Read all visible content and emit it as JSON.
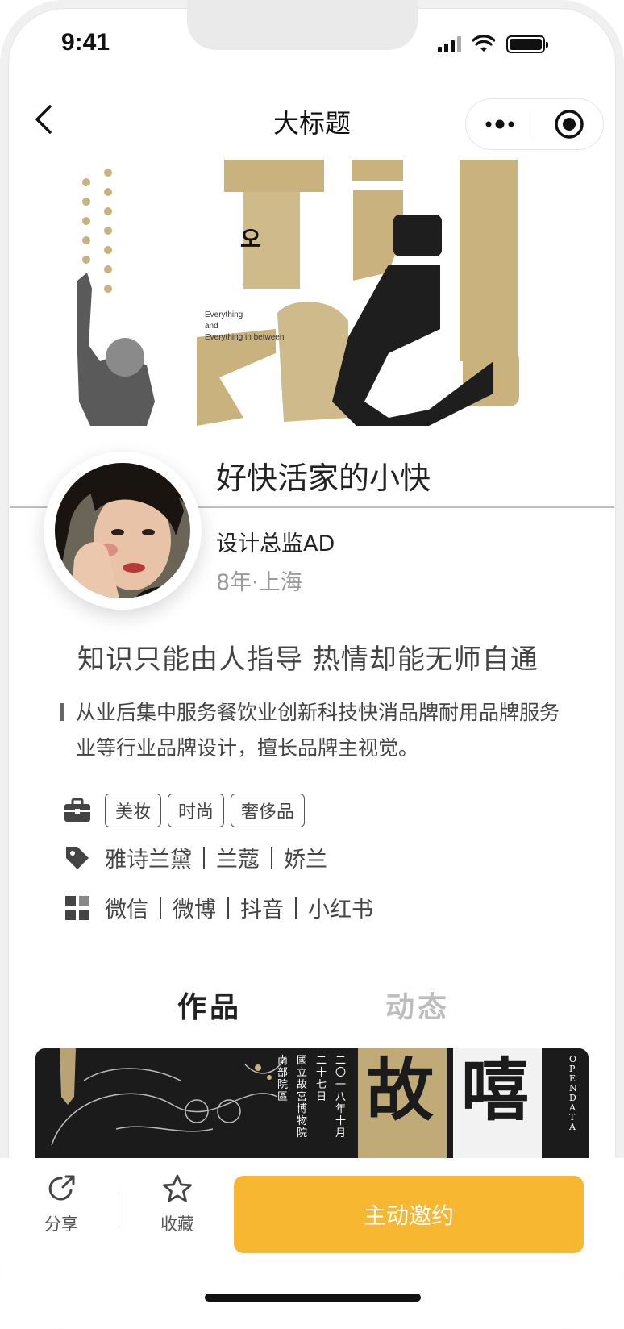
{
  "status_bar": {
    "time": "9:41"
  },
  "nav": {
    "title": "大标题"
  },
  "hero": {
    "poster_lines": [
      "Everything",
      "and",
      "Everything in between"
    ]
  },
  "profile": {
    "name": "好快活家的小快",
    "role": "设计总监AD",
    "meta": "8年·上海"
  },
  "motto": "知识只能由人指导 热情却能无师自通",
  "bio": "从业后集中服务餐饮业创新科技快消品牌耐用品牌服务业等行业品牌设计，擅长品牌主视觉。",
  "industries": [
    "美妆",
    "时尚",
    "奢侈品"
  ],
  "brands": [
    "雅诗兰黛",
    "兰蔻",
    "娇兰"
  ],
  "platforms": [
    "微信",
    "微博",
    "抖音",
    "小红书"
  ],
  "tabs": {
    "works": "作品",
    "posts": "动态"
  },
  "work_card": {
    "text_col_1": "南部院區",
    "text_col_2": "國立故宮博物院",
    "text_col_3": "二十七日",
    "text_col_4": "二〇一八年十月",
    "big_1": "故",
    "big_2": "嘻",
    "side": "OPEN DATA"
  },
  "bottom_bar": {
    "share_label": "分享",
    "favorite_label": "收藏",
    "invite_label": "主动邀约"
  },
  "colors": {
    "accent": "#f8b731",
    "poster_gold": "#c9b27d"
  },
  "icons": [
    "back-icon",
    "more-icon",
    "target-icon",
    "briefcase-icon",
    "tag-icon",
    "apps-icon",
    "share-icon",
    "star-icon"
  ]
}
